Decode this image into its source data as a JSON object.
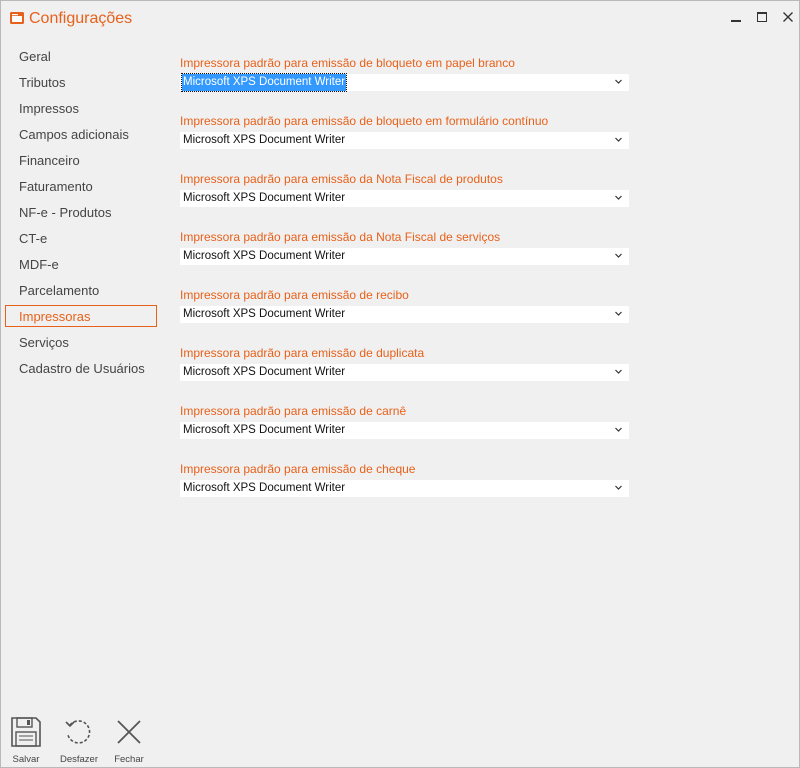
{
  "window": {
    "title": "Configurações"
  },
  "colors": {
    "accent": "#e8611a",
    "selection": "#3399ff"
  },
  "sidebar": {
    "items": [
      {
        "label": "Geral"
      },
      {
        "label": "Tributos"
      },
      {
        "label": "Impressos"
      },
      {
        "label": "Campos adicionais"
      },
      {
        "label": "Financeiro"
      },
      {
        "label": "Faturamento"
      },
      {
        "label": "NF-e - Produtos"
      },
      {
        "label": "CT-e"
      },
      {
        "label": "MDF-e"
      },
      {
        "label": "Parcelamento"
      },
      {
        "label": "Impressoras",
        "active": true
      },
      {
        "label": "Serviços"
      },
      {
        "label": "Cadastro de Usuários"
      }
    ]
  },
  "printers": {
    "fields": [
      {
        "label": "Impressora padrão para emissão de bloqueto em papel branco",
        "value": "Microsoft XPS Document Writer"
      },
      {
        "label": "Impressora padrão para emissão de bloqueto em formulário contínuo",
        "value": "Microsoft XPS Document Writer"
      },
      {
        "label": "Impressora padrão para emissão da Nota Fiscal de produtos",
        "value": "Microsoft XPS Document Writer"
      },
      {
        "label": "Impressora padrão para emissão da Nota Fiscal de serviços",
        "value": "Microsoft XPS Document Writer"
      },
      {
        "label": "Impressora padrão para emissão de recibo",
        "value": "Microsoft XPS Document Writer"
      },
      {
        "label": "Impressora padrão para emissão de duplicata",
        "value": "Microsoft XPS Document Writer"
      },
      {
        "label": "Impressora padrão para emissão de carnê",
        "value": "Microsoft XPS Document Writer"
      },
      {
        "label": "Impressora padrão para emissão de cheque",
        "value": "Microsoft XPS Document Writer"
      }
    ]
  },
  "toolbar": {
    "save_label": "Salvar",
    "undo_label": "Desfazer",
    "close_label": "Fechar"
  },
  "icons": {
    "app": "app-window-icon",
    "minimize": "minimize-icon",
    "maximize": "maximize-icon",
    "close": "close-icon",
    "save": "floppy-disk-icon",
    "undo": "undo-icon",
    "fechar": "x-icon",
    "dropdown": "chevron-down-icon"
  }
}
